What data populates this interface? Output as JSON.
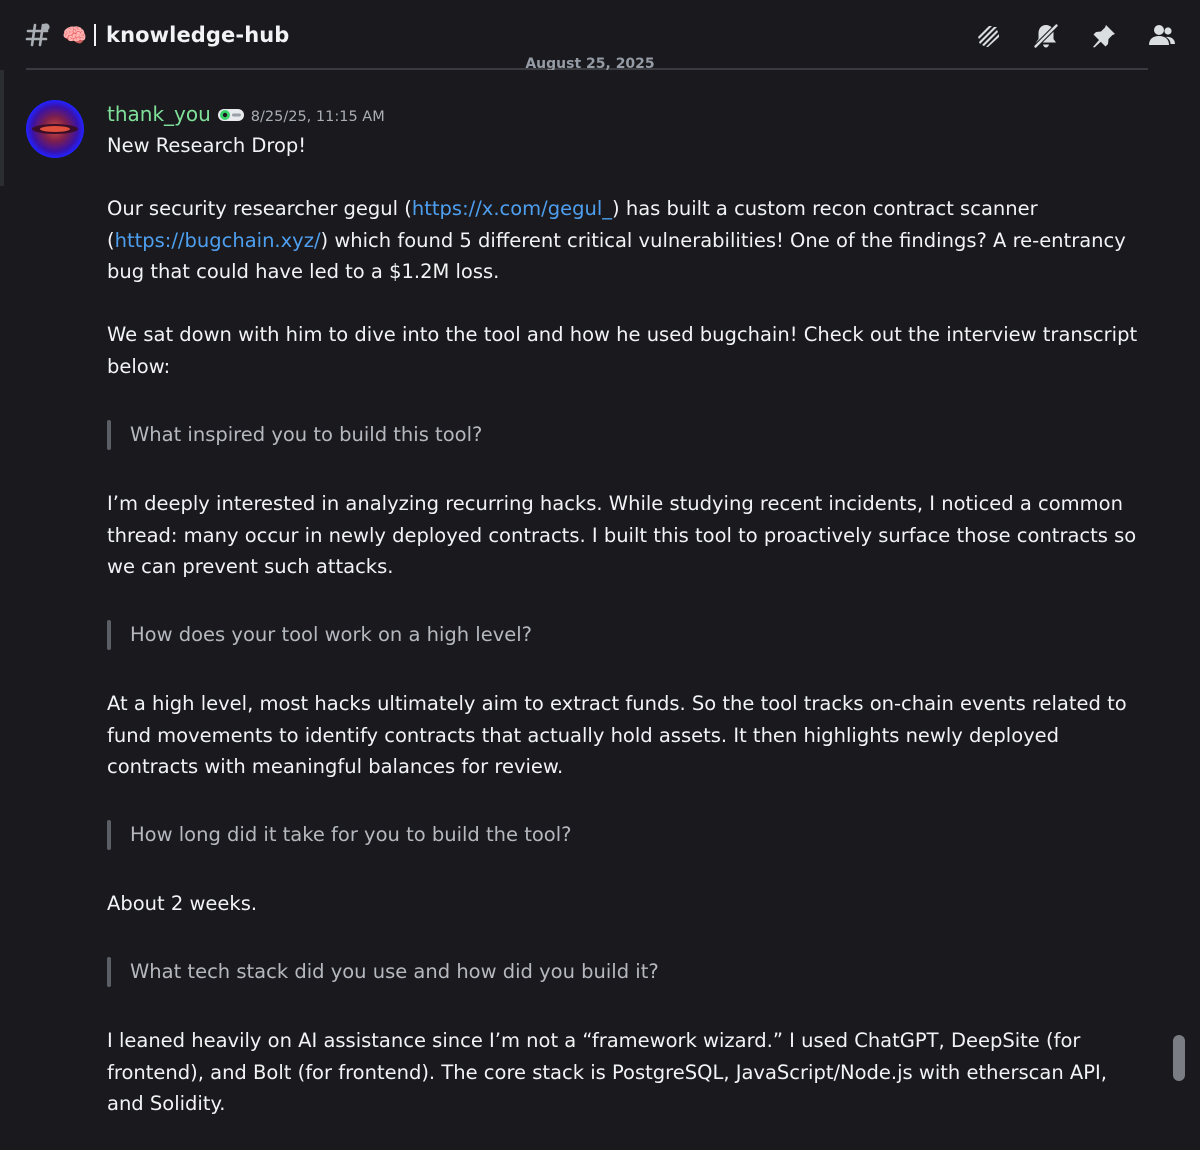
{
  "header": {
    "channel_emoji": "🧠",
    "channel_name": "knowledge-hub",
    "tools": [
      "threads-icon",
      "notification-muted-icon",
      "pin-icon",
      "member-list-icon"
    ]
  },
  "date_divider": "August 25, 2025",
  "message": {
    "author": "thank_you",
    "timestamp": "8/25/25, 11:15 AM",
    "paragraph1": "New Research Drop!",
    "paragraph2": {
      "line1_pre": "Our security researcher gegul (",
      "link1": "https://x.com/gegul_",
      "line1_post": ") has built a custom recon contract scanner",
      "line2_pre": "(",
      "link2": "https://bugchain.xyz/",
      "line2_post": ") which found 5 different critical vulnerabilities! One of the findings? A re-entrancy",
      "line3": "bug that could have led to a $1.2M loss."
    },
    "paragraph3": {
      "line1": "We sat down with him to dive into the tool and how he used bugchain! Check out the interview transcript",
      "line2": "below:"
    },
    "qa": [
      {
        "question": "What inspired you to build this tool?",
        "answer_lines": [
          "I’m deeply interested in analyzing recurring hacks. While studying recent incidents, I noticed a common",
          "thread: many occur in newly deployed contracts. I built this tool to proactively surface those contracts so",
          "we can prevent such attacks."
        ]
      },
      {
        "question": "How does your tool work on a high level?",
        "answer_lines": [
          "At a high level, most hacks ultimately aim to extract funds. So the tool tracks on-chain events related to",
          "fund movements to identify contracts that actually hold assets. It then highlights newly deployed",
          "contracts with meaningful balances for review."
        ]
      },
      {
        "question": "How long did it take for you to build the tool?",
        "answer_lines": [
          "About 2 weeks."
        ]
      },
      {
        "question": "What tech stack did you use and how did you build it?",
        "answer_lines": [
          "I leaned heavily on AI assistance since I’m not a “framework wizard.” I used ChatGPT, DeepSite (for",
          "frontend), and Bolt (for frontend). The core stack is PostgreSQL, JavaScript/Node.js with etherscan API,",
          "and Solidity."
        ]
      }
    ]
  }
}
